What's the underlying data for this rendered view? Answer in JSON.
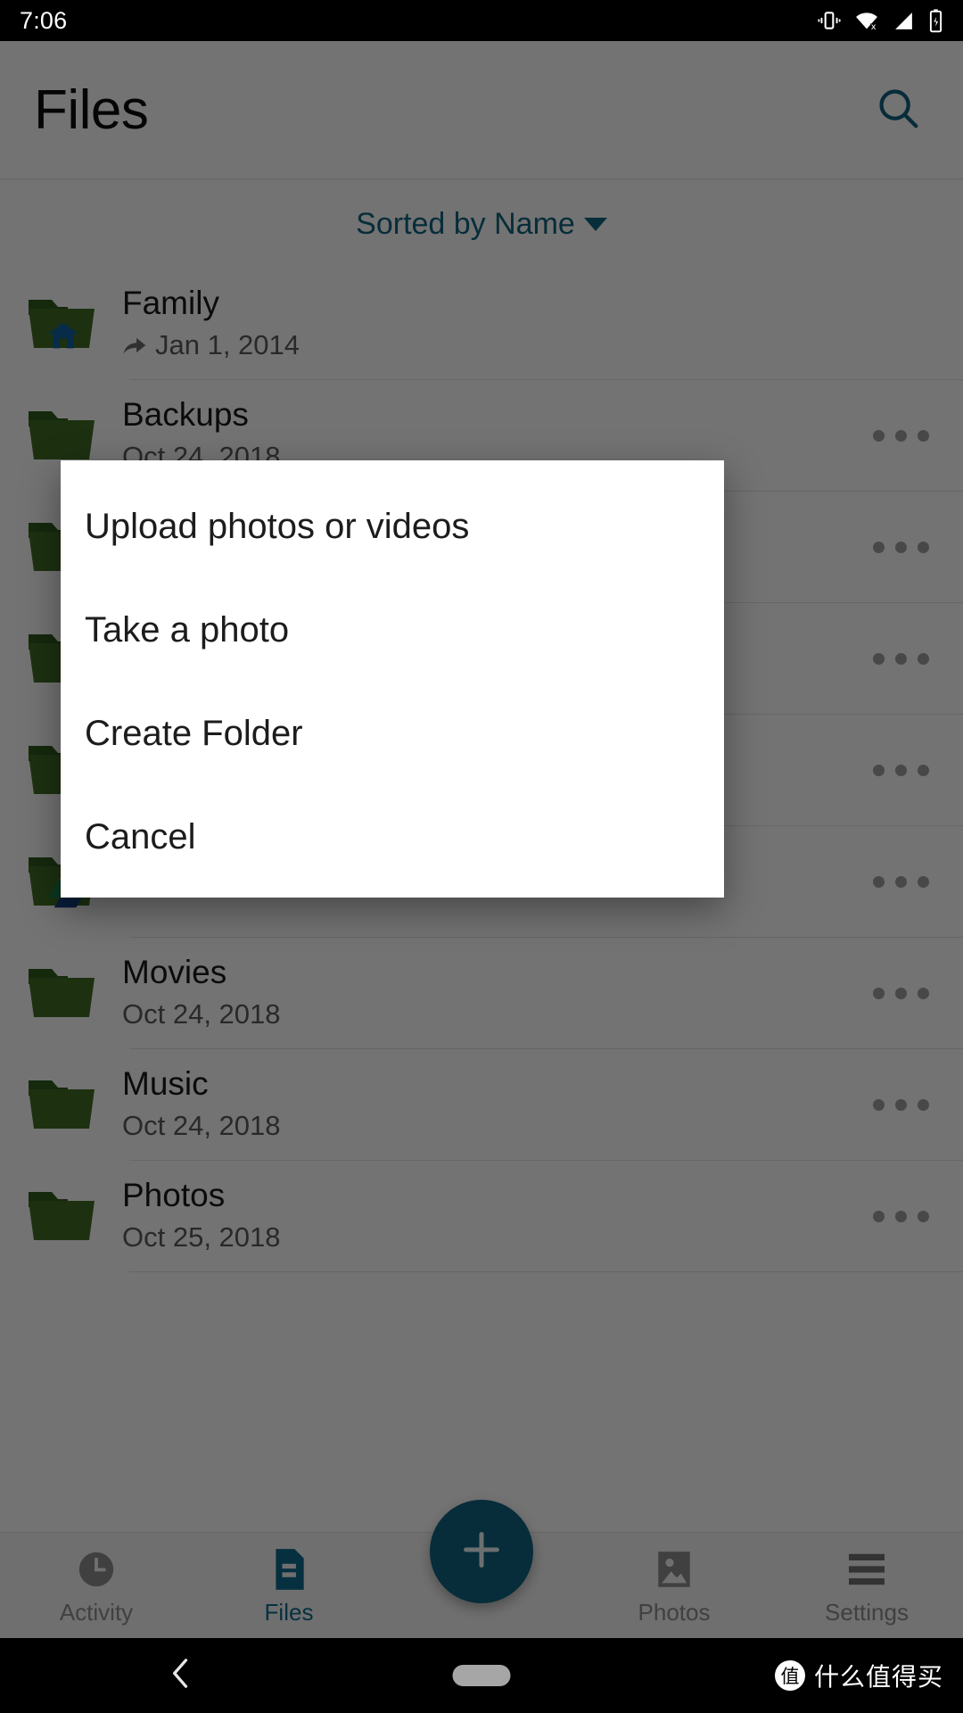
{
  "status_bar": {
    "time": "7:06",
    "icons": [
      "vibrate-icon",
      "wifi-off-icon",
      "signal-icon",
      "battery-charging-icon"
    ]
  },
  "app_bar": {
    "title": "Files",
    "search_icon": "search-icon"
  },
  "sort_bar": {
    "label": "Sorted by Name",
    "caret_icon": "chevron-down-icon"
  },
  "colors": {
    "accent": "#10617f",
    "folder": "#3f6b26",
    "folder_tab": "#2f5a1d",
    "scrim": "rgba(0,0,0,0.54)"
  },
  "file_list": [
    {
      "name": "Family",
      "date": "Jan 1, 2014",
      "shared": true,
      "badge": "home-icon",
      "overflow": false
    },
    {
      "name": "Backups",
      "date": "Oct 24, 2018",
      "shared": false,
      "badge": "",
      "overflow": true
    },
    {
      "name": "",
      "date": "",
      "shared": false,
      "badge": "",
      "overflow": true
    },
    {
      "name": "",
      "date": "",
      "shared": false,
      "badge": "",
      "overflow": true
    },
    {
      "name": "",
      "date": "",
      "shared": false,
      "badge": "",
      "overflow": true
    },
    {
      "name": "",
      "date": "",
      "shared": false,
      "badge": "drive-icon",
      "overflow": true
    },
    {
      "name": "Movies",
      "date": "Oct 24, 2018",
      "shared": false,
      "badge": "",
      "overflow": true
    },
    {
      "name": "Music",
      "date": "Oct 24, 2018",
      "shared": false,
      "badge": "",
      "overflow": true
    },
    {
      "name": "Photos",
      "date": "Oct 25, 2018",
      "shared": false,
      "badge": "",
      "overflow": true
    }
  ],
  "dialog": {
    "items": [
      {
        "label": "Upload photos or videos"
      },
      {
        "label": "Take a photo"
      },
      {
        "label": "Create Folder"
      },
      {
        "label": "Cancel"
      }
    ]
  },
  "bottom_nav": {
    "items": [
      {
        "label": "Activity",
        "icon": "clock-icon",
        "active": false
      },
      {
        "label": "Files",
        "icon": "document-icon",
        "active": true
      },
      {
        "label": "Photos",
        "icon": "image-icon",
        "active": false
      },
      {
        "label": "Settings",
        "icon": "menu-icon",
        "active": false
      }
    ],
    "fab_icon": "plus-icon"
  },
  "system_nav": {
    "back_icon": "back-chevron-icon",
    "home_pill": "home-pill",
    "watermark_badge": "值",
    "watermark_text": "什么值得买"
  }
}
